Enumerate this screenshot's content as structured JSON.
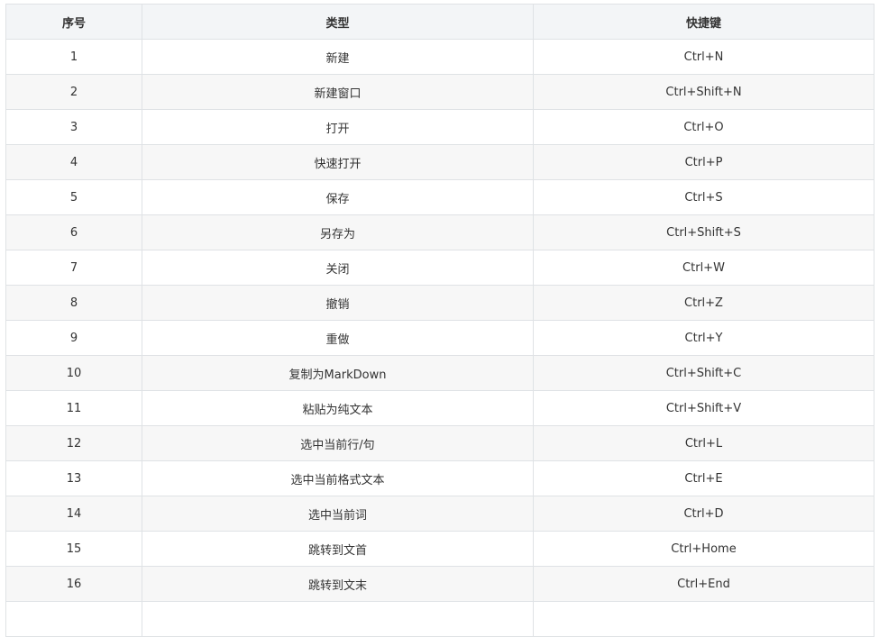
{
  "table": {
    "headers": [
      "序号",
      "类型",
      "快捷键"
    ],
    "rows": [
      [
        "1",
        "新建",
        "Ctrl+N"
      ],
      [
        "2",
        "新建窗口",
        "Ctrl+Shift+N"
      ],
      [
        "3",
        "打开",
        "Ctrl+O"
      ],
      [
        "4",
        "快速打开",
        "Ctrl+P"
      ],
      [
        "5",
        "保存",
        "Ctrl+S"
      ],
      [
        "6",
        "另存为",
        "Ctrl+Shift+S"
      ],
      [
        "7",
        "关闭",
        "Ctrl+W"
      ],
      [
        "8",
        "撤销",
        "Ctrl+Z"
      ],
      [
        "9",
        "重做",
        "Ctrl+Y"
      ],
      [
        "10",
        "复制为MarkDown",
        "Ctrl+Shift+C"
      ],
      [
        "11",
        "粘贴为纯文本",
        "Ctrl+Shift+V"
      ],
      [
        "12",
        "选中当前行/句",
        "Ctrl+L"
      ],
      [
        "13",
        "选中当前格式文本",
        "Ctrl+E"
      ],
      [
        "14",
        "选中当前词",
        "Ctrl+D"
      ],
      [
        "15",
        "跳转到文首",
        "Ctrl+Home"
      ],
      [
        "16",
        "跳转到文末",
        "Ctrl+End"
      ]
    ]
  },
  "colors": {
    "border": "#dfe2e5",
    "header_bg": "#f3f5f7",
    "stripe_bg": "#f7f7f7",
    "text": "#333333"
  }
}
